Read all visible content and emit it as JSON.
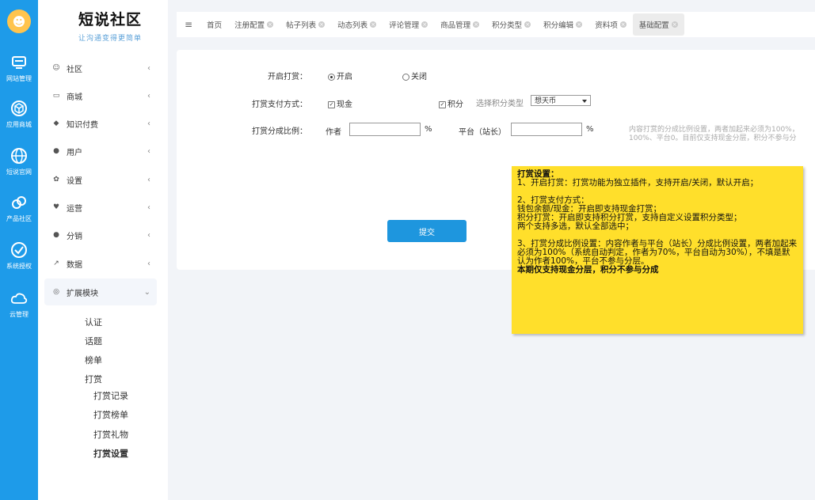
{
  "rail": {
    "items": [
      {
        "label": "网站管理",
        "icon": "monitor-icon"
      },
      {
        "label": "应用商城",
        "icon": "cube-icon"
      },
      {
        "label": "短说官网",
        "icon": "globe-icon"
      },
      {
        "label": "产品社区",
        "icon": "link-icon"
      },
      {
        "label": "系统授权",
        "icon": "shield-check-icon"
      },
      {
        "label": "云管理",
        "icon": "cloud-icon"
      }
    ]
  },
  "brand": {
    "title": "短说社区",
    "slogan": "让沟通变得更简单"
  },
  "sidebar": {
    "items": [
      {
        "label": "社区",
        "icon": "chat-icon",
        "glyph": "☺"
      },
      {
        "label": "商城",
        "icon": "laptop-icon",
        "glyph": "▭"
      },
      {
        "label": "知识付费",
        "icon": "graduation-cap-icon",
        "glyph": "◆"
      },
      {
        "label": "用户",
        "icon": "user-icon",
        "glyph": "●"
      },
      {
        "label": "设置",
        "icon": "gear-icon",
        "glyph": "✿"
      },
      {
        "label": "运营",
        "icon": "heartbeat-icon",
        "glyph": "♥"
      },
      {
        "label": "分销",
        "icon": "users-icon",
        "glyph": "●"
      },
      {
        "label": "数据",
        "icon": "chart-line-icon",
        "glyph": "↗"
      },
      {
        "label": "扩展模块",
        "icon": "puzzle-icon",
        "glyph": "◎"
      }
    ],
    "subitems": [
      "认证",
      "话题",
      "榜单",
      "打赏"
    ],
    "subsubitems": [
      "打赏记录",
      "打赏榜单",
      "打赏礼物",
      "打赏设置"
    ]
  },
  "tabs": [
    "首页",
    "注册配置",
    "帖子列表",
    "动态列表",
    "评论管理",
    "商品管理",
    "积分类型",
    "积分编辑",
    "资料项",
    "基础配置"
  ],
  "form": {
    "enable_label": "开启打赏：",
    "enable_on": "开启",
    "enable_off": "关闭",
    "pay_label": "打赏支付方式：",
    "pay_cash": "现金",
    "pay_points": "积分",
    "points_type_label": "选择积分类型",
    "points_type_value": "想天币",
    "split_label": "打赏分成比例：",
    "author_label": "作者",
    "percent": "%",
    "platform_label": "平台（站长）",
    "hint_line1": "内容打赏的分成比例设置，两者加起来必须为100%，",
    "hint_line2": "100%、平台0。目前仅支持现金分层，积分不参与分",
    "submit": "提交"
  },
  "note": {
    "title": "打赏设置：",
    "line1": "1、开启打赏：打赏功能为独立插件，支持开启/关闭，默认开启；",
    "line2": "2、打赏支付方式：",
    "line3": "钱包余额/现金：开启即支持现金打赏；",
    "line4": "积分打赏：开启即支持积分打赏，支持自定义设置积分类型；",
    "line5": "两个支持多选，默认全部选中；",
    "line6": "3、打赏分成比例设置：内容作者与平台（站长）分成比例设置，两者加起来必须为100%（系统自动判定，作者为70%，平台自动为30%），不填是默认为作者100%，平台不参与分层。",
    "line7": "本期仅支持现金分层，积分不参与分成"
  }
}
